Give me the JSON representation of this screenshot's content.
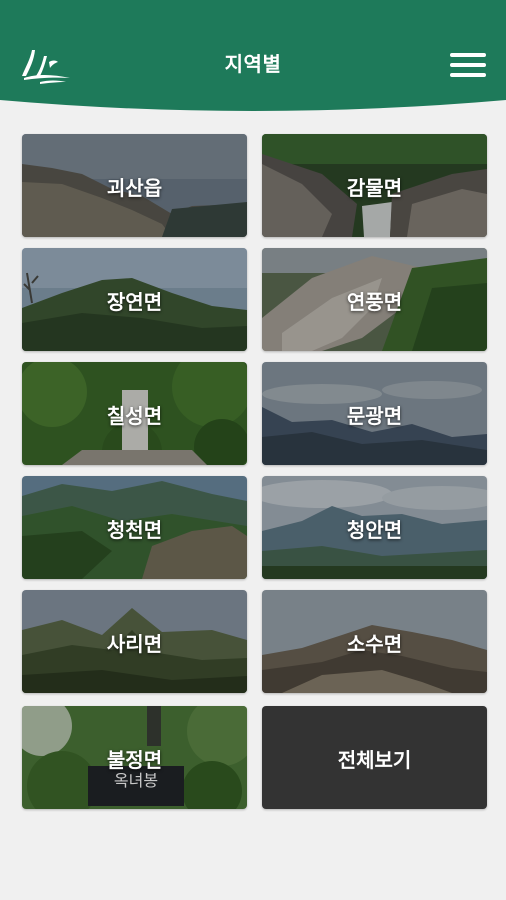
{
  "header": {
    "title": "지역별",
    "logo_icon": "mountain-logo-icon",
    "menu_icon": "hamburger-menu-icon",
    "brand_color": "#1e7a5a"
  },
  "regions": [
    {
      "label": "괴산읍",
      "scene": "rocky-ridge-sky"
    },
    {
      "label": "감물면",
      "scene": "rock-waterfall-forest"
    },
    {
      "label": "장연면",
      "scene": "forest-peak-sky"
    },
    {
      "label": "연풍면",
      "scene": "granite-slope-forest"
    },
    {
      "label": "칠성면",
      "scene": "summit-stone-forest"
    },
    {
      "label": "문광면",
      "scene": "mountain-range-clouds"
    },
    {
      "label": "청천면",
      "scene": "green-valley-ridges"
    },
    {
      "label": "청안면",
      "scene": "distant-peaks-village"
    },
    {
      "label": "사리면",
      "scene": "pointed-peak-forest"
    },
    {
      "label": "소수면",
      "scene": "rocky-peak-haze"
    },
    {
      "label": "불정면",
      "scene": "summit-sign-forest"
    }
  ],
  "view_all": {
    "label": "전체보기"
  },
  "summit_sign_text": "옥녀봉"
}
